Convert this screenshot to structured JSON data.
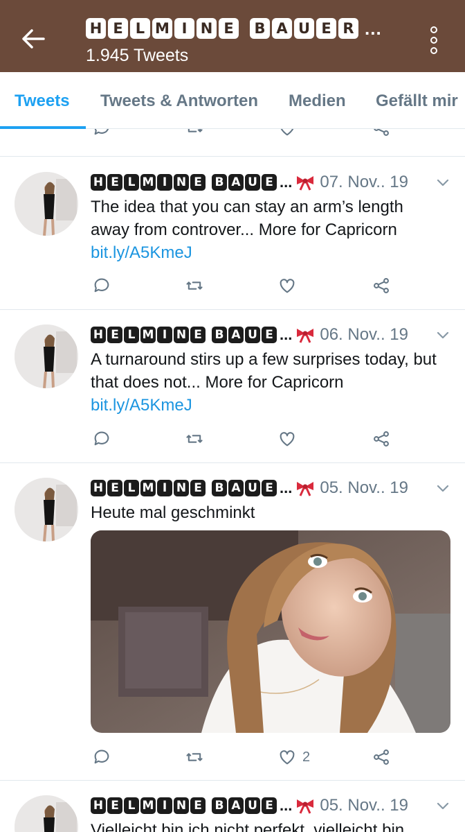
{
  "header": {
    "title_letters": [
      "H",
      "E",
      "L",
      "M",
      "I",
      "N",
      "E",
      "",
      "B",
      "A",
      "U",
      "E",
      "R"
    ],
    "title_ellipsis": "...",
    "subtitle": "1.945 Tweets",
    "background": "#6b4a3a",
    "back_icon": "arrow-left-icon",
    "menu_icon": "more-vertical-icon"
  },
  "tabs": [
    {
      "label": "Tweets",
      "active": true
    },
    {
      "label": "Tweets & Antworten",
      "active": false
    },
    {
      "label": "Medien",
      "active": false
    },
    {
      "label": "Gefällt mir",
      "active": false
    }
  ],
  "tweets": [
    {
      "name_letters": [
        "H",
        "E",
        "L",
        "M",
        "I",
        "N",
        "E",
        "",
        "B",
        "A",
        "U",
        "E"
      ],
      "name_ellipsis": "...",
      "date": "07. Nov.. 19",
      "text": "The idea that you can stay an arm’s length away from controver... More for Capricorn ",
      "link": "bit.ly/A5KmeJ",
      "likes": ""
    },
    {
      "name_letters": [
        "H",
        "E",
        "L",
        "M",
        "I",
        "N",
        "E",
        "",
        "B",
        "A",
        "U",
        "E"
      ],
      "name_ellipsis": "...",
      "date": "06. Nov.. 19",
      "text": "A turnaround stirs up a few surprises today, but that does not... More for Capricorn ",
      "link": "bit.ly/A5KmeJ",
      "likes": ""
    },
    {
      "name_letters": [
        "H",
        "E",
        "L",
        "M",
        "I",
        "N",
        "E",
        "",
        "B",
        "A",
        "U",
        "E"
      ],
      "name_ellipsis": "...",
      "date": "05. Nov.. 19",
      "text": "Heute mal geschminkt",
      "link": "",
      "likes": "2"
    },
    {
      "name_letters": [
        "H",
        "E",
        "L",
        "M",
        "I",
        "N",
        "E",
        "",
        "B",
        "A",
        "U",
        "E"
      ],
      "name_ellipsis": "...",
      "date": "05. Nov.. 19",
      "text": "Vielleicht bin ich nicht perfekt, vielleicht bin",
      "link": "",
      "likes": ""
    }
  ],
  "colors": {
    "accent": "#1da1f2",
    "link": "#1b95e0",
    "muted": "#657786",
    "divider": "#e1e8ed"
  }
}
